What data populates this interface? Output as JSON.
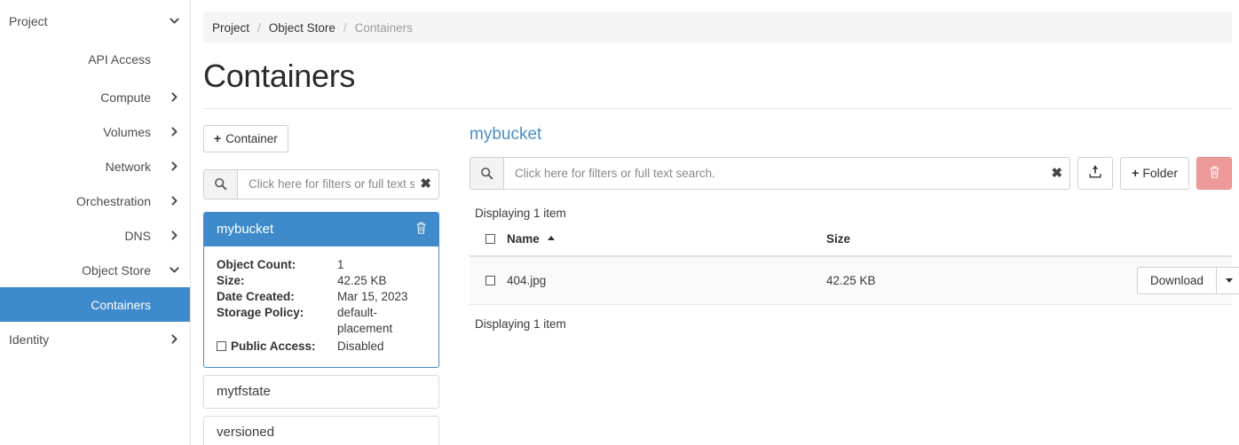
{
  "sidebar": {
    "items": [
      {
        "label": "Project",
        "level": 0,
        "icon": "chevron-down-icon",
        "active": false,
        "name": "sidebar-item-project"
      },
      {
        "label": "API Access",
        "level": 1,
        "icon": "none",
        "active": false,
        "name": "sidebar-item-api-access"
      },
      {
        "label": "Compute",
        "level": 1,
        "icon": "chevron-right-icon",
        "active": false,
        "name": "sidebar-item-compute"
      },
      {
        "label": "Volumes",
        "level": 1,
        "icon": "chevron-right-icon",
        "active": false,
        "name": "sidebar-item-volumes"
      },
      {
        "label": "Network",
        "level": 1,
        "icon": "chevron-right-icon",
        "active": false,
        "name": "sidebar-item-network"
      },
      {
        "label": "Orchestration",
        "level": 1,
        "icon": "chevron-right-icon",
        "active": false,
        "name": "sidebar-item-orchestration"
      },
      {
        "label": "DNS",
        "level": 1,
        "icon": "chevron-right-icon",
        "active": false,
        "name": "sidebar-item-dns"
      },
      {
        "label": "Object Store",
        "level": 1,
        "icon": "chevron-down-icon",
        "active": false,
        "name": "sidebar-item-object-store"
      },
      {
        "label": "Containers",
        "level": 2,
        "icon": "none",
        "active": true,
        "name": "sidebar-item-containers"
      },
      {
        "label": "Identity",
        "level": 0,
        "icon": "chevron-right-icon",
        "active": false,
        "name": "sidebar-item-identity"
      }
    ]
  },
  "breadcrumb": {
    "items": [
      "Project",
      "Object Store",
      "Containers"
    ],
    "separator": "/"
  },
  "page": {
    "title": "Containers"
  },
  "containers_panel": {
    "create_button": {
      "label": "Container",
      "plus": "+"
    },
    "filter": {
      "placeholder": "Click here for filters or full text search.",
      "value": "",
      "search_icon": "search-icon",
      "clear_icon": "clear-x-icon"
    },
    "selected_card": {
      "name": "mybucket",
      "delete_icon": "trash-icon",
      "details": [
        {
          "key": "Object Count:",
          "value": "1"
        },
        {
          "key": "Size:",
          "value": "42.25 KB"
        },
        {
          "key": "Date Created:",
          "value": "Mar 15, 2023"
        },
        {
          "key": "Storage Policy:",
          "value": "default-placement"
        }
      ],
      "public_access": {
        "key": "Public Access:",
        "value": "Disabled",
        "checked": false
      }
    },
    "other_containers": [
      "mytfstate",
      "versioned"
    ]
  },
  "objects_panel": {
    "bucket_name": "mybucket",
    "filter": {
      "placeholder": "Click here for filters or full text search.",
      "value": "",
      "search_icon": "search-icon",
      "clear_icon": "clear-x-icon"
    },
    "toolbar": {
      "upload_icon": "upload-icon",
      "folder_button": {
        "label": "Folder",
        "plus": "+"
      },
      "delete_icon": "trash-icon"
    },
    "count_top": "Displaying 1 item",
    "count_bottom": "Displaying 1 item",
    "table": {
      "columns": [
        "Name",
        "Size"
      ],
      "sort_column": "Name",
      "sort_direction": "asc",
      "rows": [
        {
          "name": "404.jpg",
          "size": "42.25 KB",
          "action": "Download"
        }
      ]
    }
  },
  "colors": {
    "accent_blue": "#3e8acb",
    "link_blue": "#4a90c7",
    "danger_red": "#ef9a9a",
    "breadcrumb_bg": "#f5f5f5",
    "row_bg": "#fafafa"
  }
}
